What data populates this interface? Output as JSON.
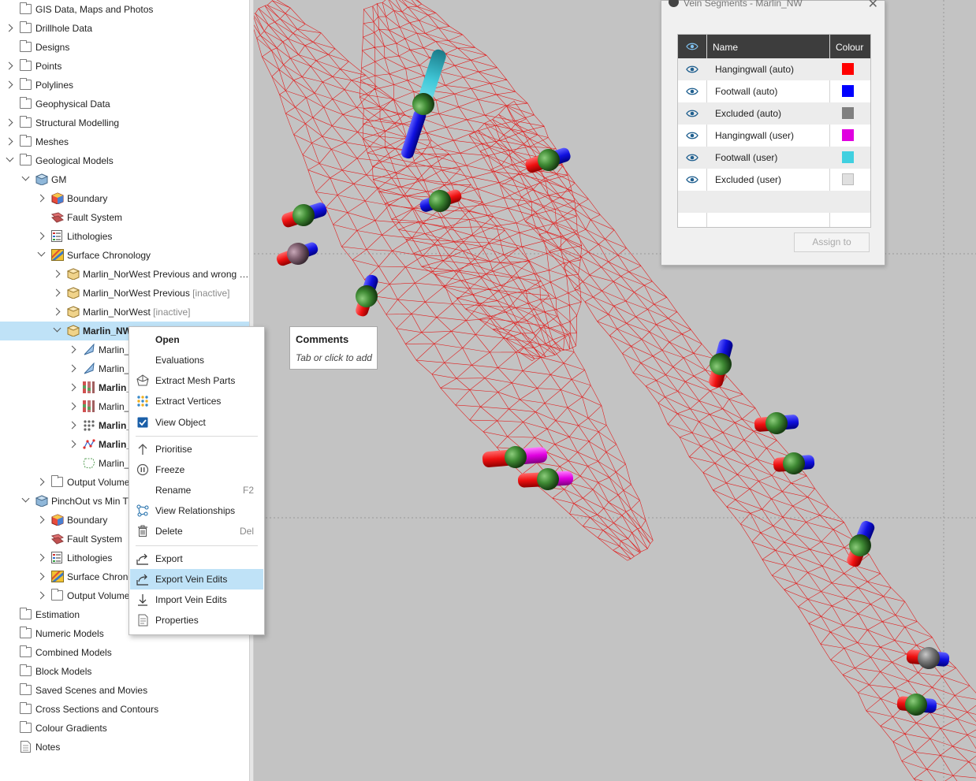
{
  "tree": {
    "items": [
      {
        "label": "GIS Data, Maps and Photos",
        "inactive": ""
      },
      {
        "label": "Drillhole Data",
        "inactive": ""
      },
      {
        "label": "Designs",
        "inactive": ""
      },
      {
        "label": "Points",
        "inactive": ""
      },
      {
        "label": "Polylines",
        "inactive": ""
      },
      {
        "label": "Geophysical Data",
        "inactive": ""
      },
      {
        "label": "Structural Modelling",
        "inactive": ""
      },
      {
        "label": "Meshes",
        "inactive": ""
      },
      {
        "label": "Geological Models",
        "inactive": ""
      },
      {
        "label": "GM",
        "inactive": ""
      },
      {
        "label": "Boundary",
        "inactive": ""
      },
      {
        "label": "Fault System",
        "inactive": ""
      },
      {
        "label": "Lithologies",
        "inactive": ""
      },
      {
        "label": "Surface Chronology",
        "inactive": ""
      },
      {
        "label": "Marlin_NorWest Previous and wrong …",
        "inactive": ""
      },
      {
        "label": "Marlin_NorWest Previous ",
        "inactive": "[inactive]"
      },
      {
        "label": "Marlin_NorWest ",
        "inactive": "[inactive]"
      },
      {
        "label": "Marlin_NW",
        "inactive": ""
      },
      {
        "label": "Marlin_",
        "inactive": ""
      },
      {
        "label": "Marlin_",
        "inactive": ""
      },
      {
        "label": "Marlin_",
        "inactive": ""
      },
      {
        "label": "Marlin_",
        "inactive": ""
      },
      {
        "label": "Marlin_",
        "inactive": ""
      },
      {
        "label": "Marlin_",
        "inactive": ""
      },
      {
        "label": "Marlin_",
        "inactive": ""
      },
      {
        "label": "Output Volume",
        "inactive": ""
      },
      {
        "label": "PinchOut vs Min Th",
        "inactive": ""
      },
      {
        "label": "Boundary",
        "inactive": ""
      },
      {
        "label": "Fault System",
        "inactive": ""
      },
      {
        "label": "Lithologies",
        "inactive": ""
      },
      {
        "label": "Surface Chrono",
        "inactive": ""
      },
      {
        "label": "Output Volume",
        "inactive": ""
      },
      {
        "label": "Estimation",
        "inactive": ""
      },
      {
        "label": "Numeric Models",
        "inactive": ""
      },
      {
        "label": "Combined Models",
        "inactive": ""
      },
      {
        "label": "Block Models",
        "inactive": ""
      },
      {
        "label": "Saved Scenes and Movies",
        "inactive": ""
      },
      {
        "label": "Cross Sections and Contours",
        "inactive": ""
      },
      {
        "label": "Colour Gradients",
        "inactive": ""
      },
      {
        "label": "Notes",
        "inactive": ""
      }
    ]
  },
  "context_menu": {
    "items": [
      {
        "label": "Open",
        "shortcut": "",
        "icon": "none"
      },
      {
        "label": "Evaluations",
        "shortcut": "",
        "icon": "none"
      },
      {
        "label": "Extract Mesh Parts",
        "shortcut": "",
        "icon": "mesh-parts-icon"
      },
      {
        "label": "Extract Vertices",
        "shortcut": "",
        "icon": "vertices-icon"
      },
      {
        "label": "View Object",
        "shortcut": "",
        "icon": "checkbox-checked-icon"
      },
      {
        "label": "Prioritise",
        "shortcut": "",
        "icon": "arrow-up-icon"
      },
      {
        "label": "Freeze",
        "shortcut": "",
        "icon": "pause-icon"
      },
      {
        "label": "Rename",
        "shortcut": "F2",
        "icon": "none"
      },
      {
        "label": "View Relationships",
        "shortcut": "",
        "icon": "relationships-icon"
      },
      {
        "label": "Delete",
        "shortcut": "Del",
        "icon": "trash-icon"
      },
      {
        "label": "Export",
        "shortcut": "",
        "icon": "export-icon"
      },
      {
        "label": "Export Vein Edits",
        "shortcut": "",
        "icon": "export-icon"
      },
      {
        "label": "Import Vein Edits",
        "shortcut": "",
        "icon": "import-icon"
      },
      {
        "label": "Properties",
        "shortcut": "",
        "icon": "properties-icon"
      }
    ]
  },
  "comments": {
    "title": "Comments",
    "hint": "Tab or click to add"
  },
  "vein_window": {
    "title": "Vein Segments - Marlin_NW",
    "headers": {
      "name": "Name",
      "colour": "Colour"
    },
    "rows": [
      {
        "name": "Hangingwall (auto)",
        "color": "#ff0000"
      },
      {
        "name": "Footwall (auto)",
        "color": "#0000ff"
      },
      {
        "name": "Excluded (auto)",
        "color": "#808080"
      },
      {
        "name": "Hangingwall (user)",
        "color": "#e000e0"
      },
      {
        "name": "Footwall (user)",
        "color": "#40d0e0"
      },
      {
        "name": "Excluded (user)",
        "color": "#e0e0e0"
      }
    ],
    "assign_label": "Assign to"
  },
  "colors": {
    "accent": "#bfe2f7",
    "scene_bg": "#c3c3c3",
    "mesh": "#e02020"
  }
}
